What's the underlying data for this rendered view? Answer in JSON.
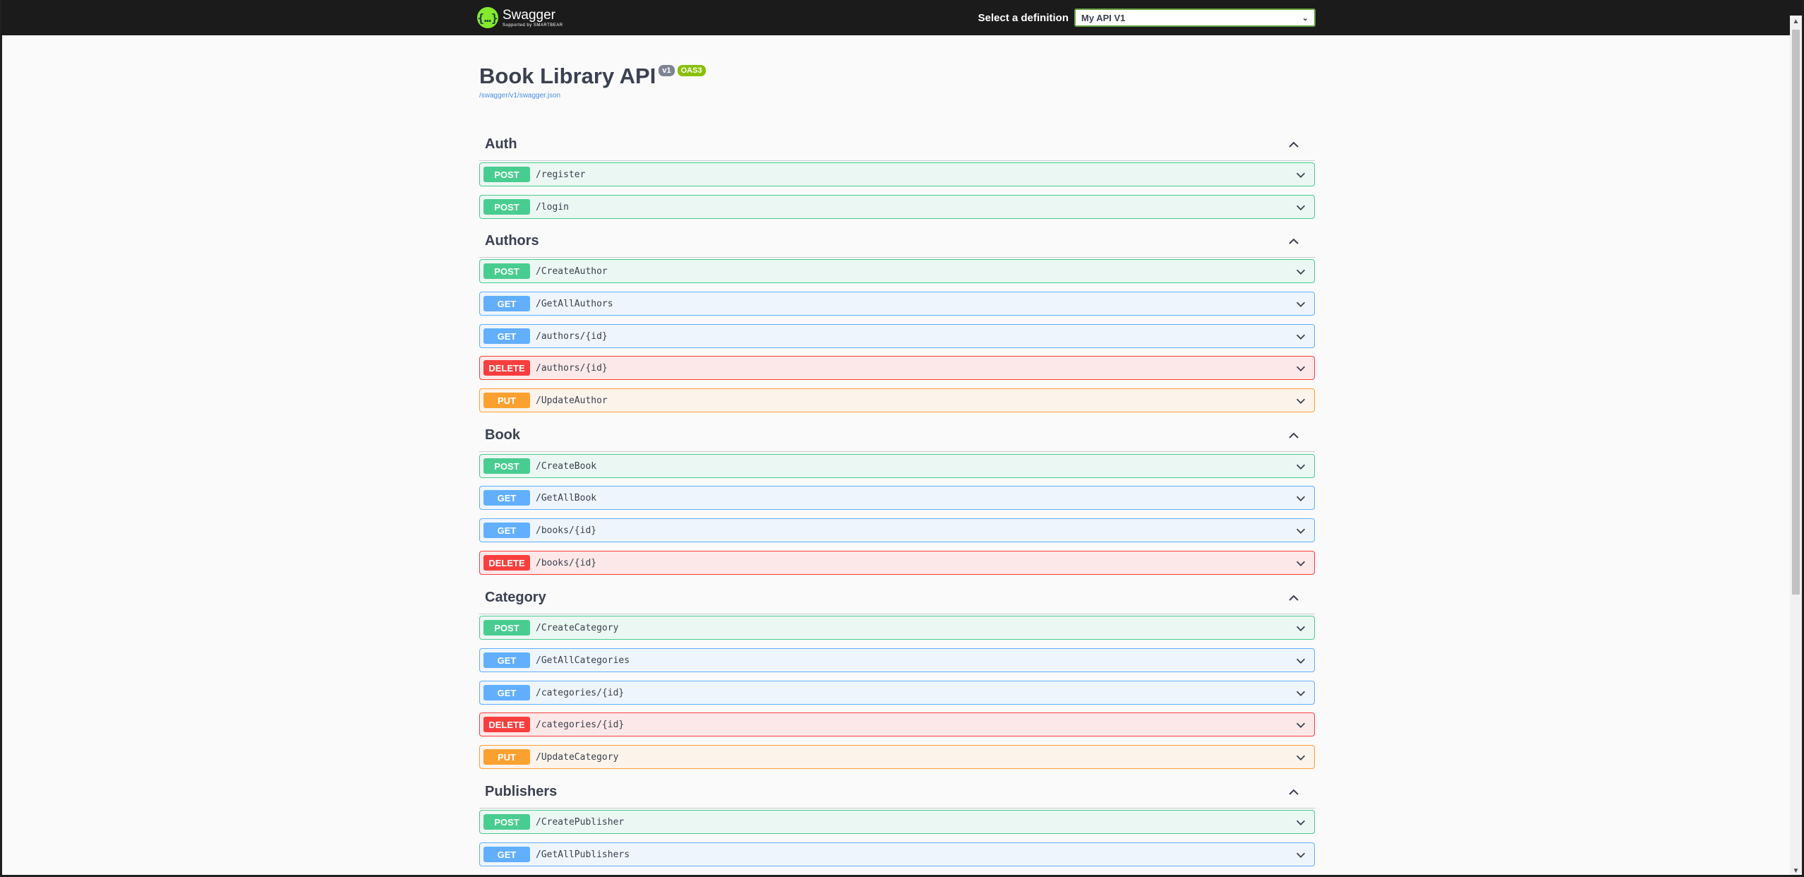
{
  "topbar": {
    "logo_title": "Swagger",
    "logo_sub": "Supported by SMARTBEAR",
    "definition_label": "Select a definition",
    "definition_value": "My API V1"
  },
  "info": {
    "title": "Book Library API",
    "version": "v1",
    "oas": "OAS3",
    "spec_link": "/swagger/v1/swagger.json"
  },
  "sections": [
    {
      "name": "Auth",
      "ops": [
        {
          "method": "POST",
          "path": "/register"
        },
        {
          "method": "POST",
          "path": "/login"
        }
      ]
    },
    {
      "name": "Authors",
      "ops": [
        {
          "method": "POST",
          "path": "/CreateAuthor"
        },
        {
          "method": "GET",
          "path": "/GetAllAuthors"
        },
        {
          "method": "GET",
          "path": "/authors/{id}"
        },
        {
          "method": "DELETE",
          "path": "/authors/{id}"
        },
        {
          "method": "PUT",
          "path": "/UpdateAuthor"
        }
      ]
    },
    {
      "name": "Book",
      "ops": [
        {
          "method": "POST",
          "path": "/CreateBook"
        },
        {
          "method": "GET",
          "path": "/GetAllBook"
        },
        {
          "method": "GET",
          "path": "/books/{id}"
        },
        {
          "method": "DELETE",
          "path": "/books/{id}"
        }
      ]
    },
    {
      "name": "Category",
      "ops": [
        {
          "method": "POST",
          "path": "/CreateCategory"
        },
        {
          "method": "GET",
          "path": "/GetAllCategories"
        },
        {
          "method": "GET",
          "path": "/categories/{id}"
        },
        {
          "method": "DELETE",
          "path": "/categories/{id}"
        },
        {
          "method": "PUT",
          "path": "/UpdateCategory"
        }
      ]
    },
    {
      "name": "Publishers",
      "ops": [
        {
          "method": "POST",
          "path": "/CreatePublisher"
        },
        {
          "method": "GET",
          "path": "/GetAllPublishers"
        }
      ]
    }
  ],
  "colors": {
    "post": "#49cc90",
    "get": "#61affe",
    "delete": "#f93e3e",
    "put": "#fca130",
    "topbar": "#1b1b1b"
  }
}
